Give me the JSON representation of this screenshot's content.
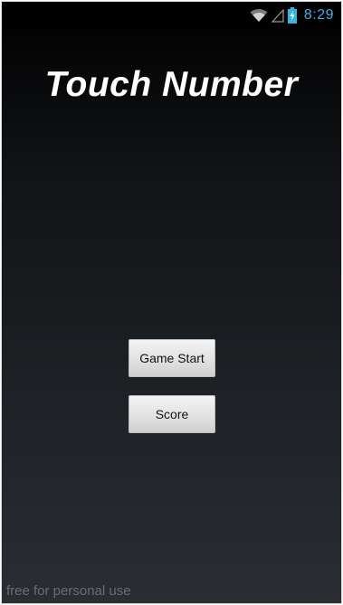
{
  "status_bar": {
    "time": "8:29",
    "icons": [
      "wifi-icon",
      "cellular-signal-icon",
      "battery-charging-icon"
    ],
    "accent_color": "#33b5e5"
  },
  "app": {
    "title": "Touch Number"
  },
  "buttons": {
    "start_label": "Game Start",
    "score_label": "Score"
  },
  "footer": {
    "text": "free for personal use"
  }
}
